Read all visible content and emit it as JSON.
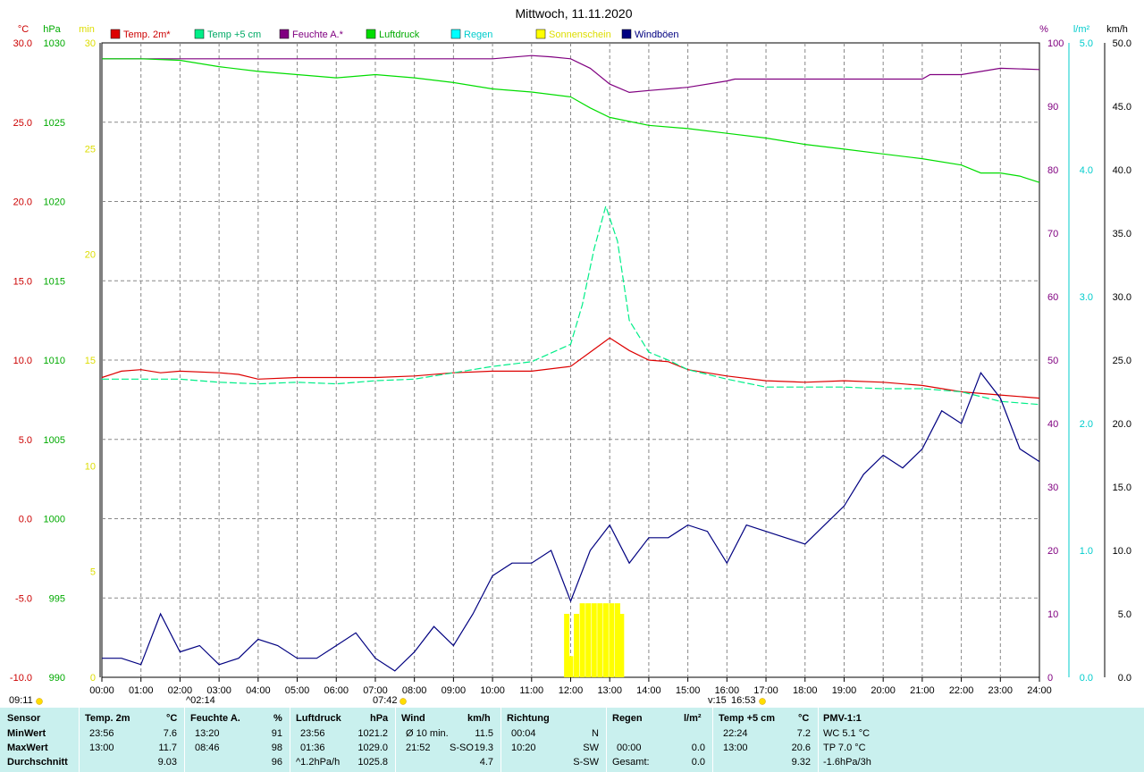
{
  "chart_data": {
    "type": "line",
    "title": "Mittwoch, 11.11.2020",
    "x_range": [
      "00:00",
      "24:00"
    ],
    "x_ticks": [
      "00:00",
      "01:00",
      "02:00",
      "03:00",
      "04:00",
      "05:00",
      "06:00",
      "07:00",
      "08:00",
      "09:00",
      "10:00",
      "11:00",
      "12:00",
      "13:00",
      "14:00",
      "15:00",
      "16:00",
      "17:00",
      "18:00",
      "19:00",
      "20:00",
      "21:00",
      "22:00",
      "23:00",
      "24:00"
    ],
    "axes": {
      "temp": {
        "unit": "°C",
        "range": [
          -10,
          30
        ],
        "ticks": [
          "30.0",
          "25.0",
          "20.0",
          "15.0",
          "10.0",
          "5.0",
          "0.0",
          "-5.0",
          "-10.0"
        ],
        "color": "#cc0000"
      },
      "pressure": {
        "unit": "hPa",
        "range": [
          990,
          1030
        ],
        "ticks": [
          "1030",
          "1025",
          "1020",
          "1015",
          "1010",
          "1005",
          "1000",
          "995",
          "990"
        ],
        "color": "#00aa00"
      },
      "sunshine": {
        "unit": "min",
        "range": [
          0,
          30
        ],
        "ticks": [
          "30",
          "25",
          "20",
          "15",
          "10",
          "5",
          "0"
        ],
        "color": "#dddd00"
      },
      "humidity": {
        "unit": "%",
        "range": [
          0,
          100
        ],
        "ticks": [
          "100",
          "90",
          "80",
          "70",
          "60",
          "50",
          "40",
          "30",
          "20",
          "10",
          "0"
        ],
        "color": "#800080"
      },
      "rain": {
        "unit": "l/m²",
        "range": [
          0,
          5
        ],
        "ticks": [
          "5.0",
          "4.0",
          "3.0",
          "2.0",
          "1.0",
          "0.0"
        ],
        "color": "#00cccc"
      },
      "wind": {
        "unit": "km/h",
        "range": [
          0,
          50
        ],
        "ticks": [
          "50.0",
          "45.0",
          "40.0",
          "35.0",
          "30.0",
          "25.0",
          "20.0",
          "15.0",
          "10.0",
          "5.0",
          "0.0"
        ],
        "color": "#000000"
      }
    },
    "legend": [
      {
        "label": "Temp. 2m*",
        "color": "#dd0000",
        "text_color": "#cc0000"
      },
      {
        "label": "Temp +5 cm",
        "color": "#00ee88",
        "text_color": "#00aa66"
      },
      {
        "label": "Feuchte A.*",
        "color": "#800080",
        "text_color": "#800080"
      },
      {
        "label": "Luftdruck",
        "color": "#00dd00",
        "text_color": "#00aa00"
      },
      {
        "label": "Regen",
        "color": "#00ffff",
        "text_color": "#00cccc"
      },
      {
        "label": "Sonnenschein",
        "color": "#ffff00",
        "text_color": "#dddd00"
      },
      {
        "label": "Windböen",
        "color": "#000080",
        "text_color": "#000080"
      }
    ],
    "series": [
      {
        "name": "Temp. 2m*",
        "axis": "temp",
        "color": "#dd0000",
        "style": "solid",
        "points": [
          [
            0,
            8.9
          ],
          [
            0.5,
            9.3
          ],
          [
            1,
            9.4
          ],
          [
            1.5,
            9.2
          ],
          [
            2,
            9.3
          ],
          [
            3,
            9.2
          ],
          [
            3.5,
            9.1
          ],
          [
            4,
            8.8
          ],
          [
            5,
            8.9
          ],
          [
            6,
            8.9
          ],
          [
            7,
            8.9
          ],
          [
            8,
            9.0
          ],
          [
            9,
            9.2
          ],
          [
            10,
            9.3
          ],
          [
            11,
            9.3
          ],
          [
            12,
            9.6
          ],
          [
            12.5,
            10.5
          ],
          [
            13,
            11.4
          ],
          [
            13.5,
            10.6
          ],
          [
            14,
            10.0
          ],
          [
            14.5,
            9.9
          ],
          [
            15,
            9.4
          ],
          [
            16,
            9.0
          ],
          [
            17,
            8.7
          ],
          [
            18,
            8.6
          ],
          [
            19,
            8.7
          ],
          [
            20,
            8.6
          ],
          [
            21,
            8.4
          ],
          [
            22,
            8.0
          ],
          [
            23,
            7.8
          ],
          [
            24,
            7.6
          ]
        ]
      },
      {
        "name": "Temp +5 cm",
        "axis": "temp",
        "color": "#00ee88",
        "style": "dashed",
        "points": [
          [
            0,
            8.8
          ],
          [
            1,
            8.8
          ],
          [
            2,
            8.8
          ],
          [
            3,
            8.6
          ],
          [
            4,
            8.5
          ],
          [
            5,
            8.6
          ],
          [
            6,
            8.5
          ],
          [
            7,
            8.7
          ],
          [
            8,
            8.8
          ],
          [
            9,
            9.2
          ],
          [
            10,
            9.6
          ],
          [
            11,
            9.9
          ],
          [
            12,
            11.0
          ],
          [
            12.3,
            13.5
          ],
          [
            12.6,
            17.0
          ],
          [
            12.9,
            19.7
          ],
          [
            13.2,
            17.5
          ],
          [
            13.5,
            12.5
          ],
          [
            14,
            10.5
          ],
          [
            14.5,
            10.0
          ],
          [
            15,
            9.4
          ],
          [
            16,
            8.8
          ],
          [
            17,
            8.3
          ],
          [
            18,
            8.3
          ],
          [
            19,
            8.3
          ],
          [
            20,
            8.2
          ],
          [
            21,
            8.2
          ],
          [
            22,
            8.0
          ],
          [
            23,
            7.4
          ],
          [
            24,
            7.2
          ]
        ]
      },
      {
        "name": "Feuchte A.*",
        "axis": "humidity",
        "color": "#800080",
        "style": "solid",
        "points": [
          [
            0,
            97.5
          ],
          [
            5,
            97.5
          ],
          [
            10,
            97.5
          ],
          [
            11,
            98.0
          ],
          [
            11.5,
            97.8
          ],
          [
            12,
            97.5
          ],
          [
            12.5,
            96.0
          ],
          [
            13,
            93.5
          ],
          [
            13.5,
            92.2
          ],
          [
            14,
            92.5
          ],
          [
            15,
            93.0
          ],
          [
            16,
            94.0
          ],
          [
            16.2,
            94.3
          ],
          [
            18,
            94.3
          ],
          [
            21,
            94.3
          ],
          [
            21.2,
            95.0
          ],
          [
            22,
            95.0
          ],
          [
            22.5,
            95.5
          ],
          [
            23,
            96.0
          ],
          [
            24,
            95.8
          ]
        ]
      },
      {
        "name": "Luftdruck",
        "axis": "pressure",
        "color": "#00dd00",
        "style": "solid",
        "points": [
          [
            0,
            1029.0
          ],
          [
            1,
            1029.0
          ],
          [
            2,
            1028.9
          ],
          [
            3,
            1028.5
          ],
          [
            4,
            1028.2
          ],
          [
            5,
            1028.0
          ],
          [
            6,
            1027.8
          ],
          [
            7,
            1028.0
          ],
          [
            8,
            1027.8
          ],
          [
            9,
            1027.5
          ],
          [
            10,
            1027.1
          ],
          [
            11,
            1026.9
          ],
          [
            12,
            1026.6
          ],
          [
            12.5,
            1025.9
          ],
          [
            13,
            1025.3
          ],
          [
            14,
            1024.8
          ],
          [
            15,
            1024.6
          ],
          [
            16,
            1024.3
          ],
          [
            17,
            1024.0
          ],
          [
            18,
            1023.6
          ],
          [
            19,
            1023.3
          ],
          [
            20,
            1023.0
          ],
          [
            21,
            1022.7
          ],
          [
            22,
            1022.3
          ],
          [
            22.5,
            1021.8
          ],
          [
            23,
            1021.8
          ],
          [
            23.5,
            1021.6
          ],
          [
            24,
            1021.2
          ]
        ]
      },
      {
        "name": "Windböen",
        "axis": "wind",
        "color": "#000080",
        "style": "solid",
        "points": [
          [
            0,
            1.5
          ],
          [
            0.5,
            1.5
          ],
          [
            1,
            1.0
          ],
          [
            1.5,
            5.0
          ],
          [
            2,
            2.0
          ],
          [
            2.5,
            2.5
          ],
          [
            3,
            1.0
          ],
          [
            3.5,
            1.5
          ],
          [
            4,
            3.0
          ],
          [
            4.5,
            2.5
          ],
          [
            5,
            1.5
          ],
          [
            5.5,
            1.5
          ],
          [
            6,
            2.5
          ],
          [
            6.5,
            3.5
          ],
          [
            7,
            1.5
          ],
          [
            7.5,
            0.5
          ],
          [
            8,
            2.0
          ],
          [
            8.5,
            4.0
          ],
          [
            9,
            2.5
          ],
          [
            9.5,
            5.0
          ],
          [
            10,
            8.0
          ],
          [
            10.5,
            9.0
          ],
          [
            11,
            9.0
          ],
          [
            11.5,
            10.0
          ],
          [
            12,
            6.0
          ],
          [
            12.5,
            10.0
          ],
          [
            13,
            12.0
          ],
          [
            13.5,
            9.0
          ],
          [
            14,
            11.0
          ],
          [
            14.5,
            11.0
          ],
          [
            15,
            12.0
          ],
          [
            15.5,
            11.5
          ],
          [
            16,
            9.0
          ],
          [
            16.5,
            12.0
          ],
          [
            17,
            11.5
          ],
          [
            17.5,
            11.0
          ],
          [
            18,
            10.5
          ],
          [
            18.5,
            12.0
          ],
          [
            19,
            13.5
          ],
          [
            19.5,
            16.0
          ],
          [
            20,
            17.5
          ],
          [
            20.5,
            16.5
          ],
          [
            21,
            18.0
          ],
          [
            21.5,
            21.0
          ],
          [
            22,
            20.0
          ],
          [
            22.5,
            24.0
          ],
          [
            23,
            22.0
          ],
          [
            23.5,
            18.0
          ],
          [
            24,
            17.0
          ]
        ]
      }
    ],
    "sunshine_bars": [
      [
        11.9,
        3.0
      ],
      [
        12.0,
        1.0
      ],
      [
        12.15,
        3.0
      ],
      [
        12.3,
        3.5
      ],
      [
        12.45,
        3.5
      ],
      [
        12.6,
        3.5
      ],
      [
        12.75,
        3.5
      ],
      [
        12.9,
        3.5
      ],
      [
        13.05,
        3.5
      ],
      [
        13.2,
        3.5
      ],
      [
        13.3,
        3.0
      ]
    ],
    "rain_total": 0.0,
    "markers": [
      {
        "time": "09:11",
        "label": "09:11"
      },
      {
        "time": "02:14",
        "label": "^02:14"
      },
      {
        "time": "07:42",
        "label": "07:42"
      },
      {
        "time": "16:15",
        "label": "v:15"
      },
      {
        "time": "16:53",
        "label": "16:53"
      }
    ]
  },
  "table": {
    "row_labels": {
      "sensor": "Sensor",
      "min": "MinWert",
      "max": "MaxWert",
      "avg": "Durchschnitt"
    },
    "temp2m": {
      "title": "Temp. 2m",
      "unit": "°C",
      "min_time": "23:56",
      "min_val": "7.6",
      "max_time": "13:00",
      "max_val": "11.7",
      "avg": "9.03"
    },
    "humidity": {
      "title": "Feuchte A.",
      "unit": "%",
      "min_time": "13:20",
      "min_val": "91",
      "max_time": "08:46",
      "max_val": "98",
      "avg": "96"
    },
    "pressure": {
      "title": "Luftdruck",
      "unit": "hPa",
      "min_time": "23:56",
      "min_val": "1021.2",
      "max_time": "01:36",
      "max_val": "1029.0",
      "trend": "^1.2hPa/h",
      "avg": "1025.8"
    },
    "wind": {
      "title": "Wind",
      "unit": "km/h",
      "min_label": "Ø 10 min.",
      "min_val": "11.5",
      "max_time": "21:52",
      "max_dir": "S-SO",
      "max_val": "19.3",
      "avg": "4.7"
    },
    "direction": {
      "title": "Richtung",
      "min_time": "00:04",
      "min_val": "N",
      "max_time": "10:20",
      "max_val": "SW",
      "avg": "S-SW"
    },
    "rain": {
      "title": "Regen",
      "unit": "l/m²",
      "max_time": "00:00",
      "max_val": "0.0",
      "total_label": "Gesamt:",
      "total_val": "0.0"
    },
    "temp5cm": {
      "title": "Temp +5 cm",
      "unit": "°C",
      "min_time": "22:24",
      "min_val": "7.2",
      "max_time": "13:00",
      "max_val": "20.6",
      "avg": "9.32"
    },
    "pmv": {
      "title": "PMV-1:1",
      "wc": "WC 5.1 °C",
      "tp": "TP 7.0 °C",
      "trend": "-1.6hPa/3h"
    }
  }
}
